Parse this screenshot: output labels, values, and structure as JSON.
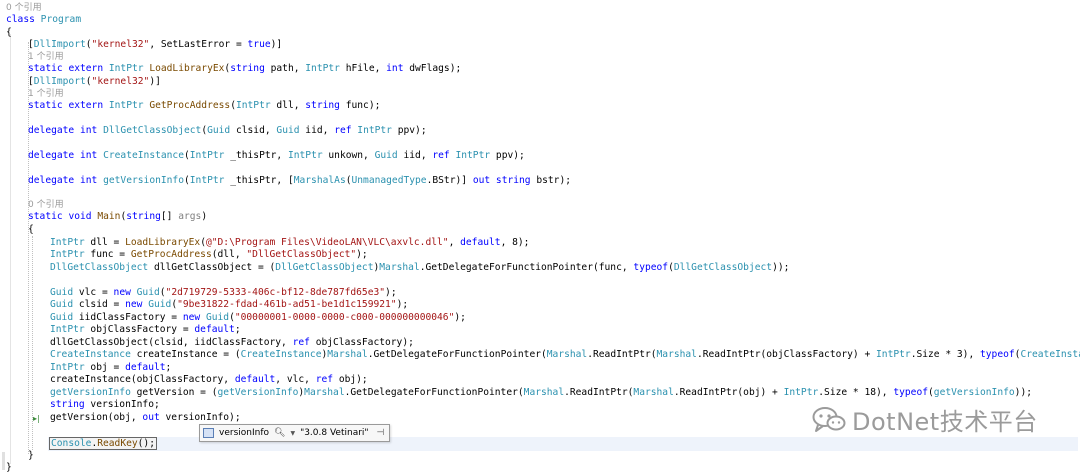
{
  "refs": {
    "zero": "0 个引用",
    "one": "1 个引用"
  },
  "lines": {
    "class_kw": "class",
    "class_name": "Program",
    "open_brace": "{",
    "close_brace": "}",
    "dllimport": "DllImport",
    "kernel32": "\"kernel32\"",
    "set_last_error": "SetLastError",
    "true_kw": "true",
    "static_kw": "static",
    "extern_kw": "extern",
    "intptr": "IntPtr",
    "load_library_ex": "LoadLibraryEx",
    "string_kw": "string",
    "int_kw": "int",
    "get_proc_address": "GetProcAddress",
    "delegate_kw": "delegate",
    "void_kw": "void",
    "ref_kw": "ref",
    "out_kw": "out",
    "new_kw": "new",
    "default_kw": "default",
    "typeof_kw": "typeof",
    "guid": "Guid",
    "dll_get_class_object": "DllGetClassObject",
    "create_instance": "CreateInstance",
    "get_version_info": "getVersionInfo",
    "marshal": "Marshal",
    "marshal_as": "MarshalAs",
    "unmanaged_type": "UnmanagedType",
    "console": "Console",
    "read_key": "ReadKey",
    "main": "Main",
    "args": "args",
    "dll_path": "@\"D:\\Program Files\\VideoLAN\\VLC\\axvlc.dll\"",
    "dll_get_class_object_str": "\"DllGetClassObject\"",
    "guid_vlc": "\"2d719729-5333-406c-bf12-8de787fd65e3\"",
    "guid_clsid": "\"9be31822-fdad-461b-ad51-be1d1c159921\"",
    "guid_iid": "\"00000001-0000-0000-c000-000000000046\""
  },
  "datatip": {
    "name": "versionInfo",
    "value": "\"3.0.8 Vetinari\""
  },
  "watermark": {
    "text": "DotNet技术平台",
    "color": "#9b9b9b"
  },
  "colors": {
    "keyword": "#0000ff",
    "type": "#2b91af",
    "string": "#a31515",
    "reference": "#9a9a9a"
  },
  "icons": [
    "search-icon",
    "pin-icon",
    "field-icon",
    "breakpoint-arrow-icon",
    "wechat-icon"
  ]
}
